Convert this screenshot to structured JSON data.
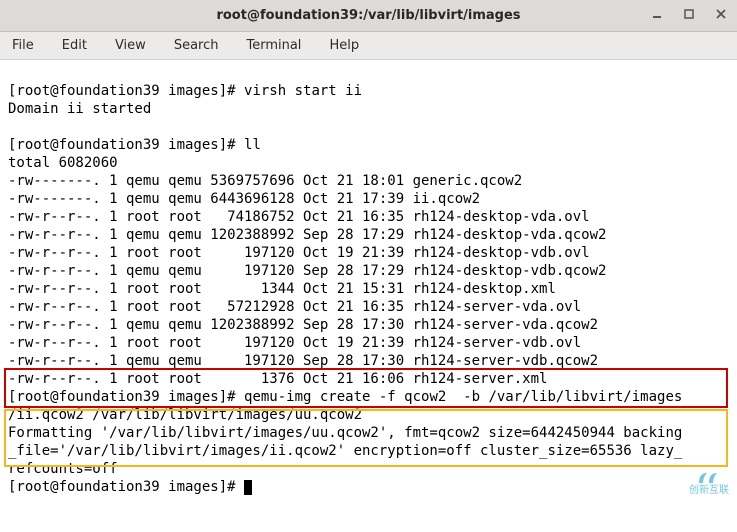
{
  "window": {
    "title": "root@foundation39:/var/lib/libvirt/images"
  },
  "menubar": {
    "file": "File",
    "edit": "Edit",
    "view": "View",
    "search": "Search",
    "terminal": "Terminal",
    "help": "Help"
  },
  "terminal": {
    "prompt1": "[root@foundation39 images]# ",
    "cmd1": "virsh start ii",
    "out1": "Domain ii started",
    "prompt2": "[root@foundation39 images]# ",
    "cmd2": "ll",
    "total": "total 6082060",
    "ls": [
      "-rw-------. 1 qemu qemu 5369757696 Oct 21 18:01 generic.qcow2",
      "-rw-------. 1 qemu qemu 6443696128 Oct 21 17:39 ii.qcow2",
      "-rw-r--r--. 1 root root   74186752 Oct 21 16:35 rh124-desktop-vda.ovl",
      "-rw-r--r--. 1 qemu qemu 1202388992 Sep 28 17:29 rh124-desktop-vda.qcow2",
      "-rw-r--r--. 1 root root     197120 Oct 19 21:39 rh124-desktop-vdb.ovl",
      "-rw-r--r--. 1 qemu qemu     197120 Sep 28 17:29 rh124-desktop-vdb.qcow2",
      "-rw-r--r--. 1 root root       1344 Oct 21 15:31 rh124-desktop.xml",
      "-rw-r--r--. 1 root root   57212928 Oct 21 16:35 rh124-server-vda.ovl",
      "-rw-r--r--. 1 qemu qemu 1202388992 Sep 28 17:30 rh124-server-vda.qcow2",
      "-rw-r--r--. 1 root root     197120 Oct 19 21:39 rh124-server-vdb.ovl",
      "-rw-r--r--. 1 qemu qemu     197120 Sep 28 17:30 rh124-server-vdb.qcow2",
      "-rw-r--r--. 1 root root       1376 Oct 21 16:06 rh124-server.xml"
    ],
    "prompt3": "[root@foundation39 images]# ",
    "cmd3a": "qemu-img create -f qcow2  -b /var/lib/libvirt/images",
    "cmd3b": "/ii.qcow2 /var/lib/libvirt/images/uu.qcow2",
    "fmt_a": "Formatting '/var/lib/libvirt/images/uu.qcow2', fmt=qcow2 size=6442450944 backing",
    "fmt_b": "_file='/var/lib/libvirt/images/ii.qcow2' encryption=off cluster_size=65536 lazy_",
    "fmt_c": "refcounts=off",
    "prompt4": "[root@foundation39 images]# "
  },
  "watermark": "创新互联"
}
